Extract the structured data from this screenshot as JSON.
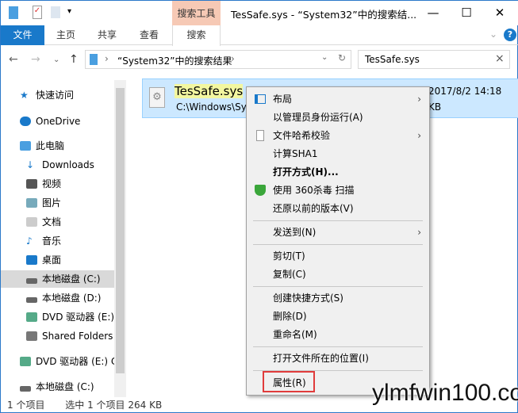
{
  "window": {
    "title": "TesSafe.sys - “System32”中的搜索结...",
    "context_tab": "搜索工具",
    "minimize": "—",
    "maximize": "☐",
    "close": "✕"
  },
  "ribbon": {
    "tabs": [
      "文件",
      "主页",
      "共享",
      "查看",
      "搜索"
    ],
    "help": "?",
    "expand": "⌄"
  },
  "address": {
    "path": "“System32”中的搜索结果",
    "search_value": "TesSafe.sys",
    "clear": "×"
  },
  "sidebar": {
    "items": [
      "快速访问",
      "OneDrive",
      "此电脑",
      "Downloads",
      "视频",
      "图片",
      "文档",
      "音乐",
      "桌面",
      "本地磁盘 (C:)",
      "本地磁盘 (D:)",
      "DVD 驱动器 (E:)",
      "Shared Folders",
      "DVD 驱动器 (E:) C",
      "本地磁盘 (C:)"
    ]
  },
  "file": {
    "name": "TesSafe.sys",
    "path": "C:\\Windows\\Sy",
    "date": "2017/8/2 14:18",
    "size": "KB"
  },
  "menu": {
    "items": [
      "布局",
      "以管理员身份运行(A)",
      "文件哈希校验",
      "计算SHA1",
      "打开方式(H)...",
      "使用 360杀毒 扫描",
      "还原以前的版本(V)",
      "发送到(N)",
      "剪切(T)",
      "复制(C)",
      "创建快捷方式(S)",
      "删除(D)",
      "重命名(M)",
      "打开文件所在的位置(I)",
      "属性(R)"
    ]
  },
  "status": {
    "count": "1 个项目",
    "selected": "选中 1 个项目  264 KB"
  },
  "watermark": "ylmfwin100.com",
  "colors": {
    "accent": "#1979ca",
    "selection": "#cce8ff",
    "highlight_box": "#e03c3c"
  }
}
